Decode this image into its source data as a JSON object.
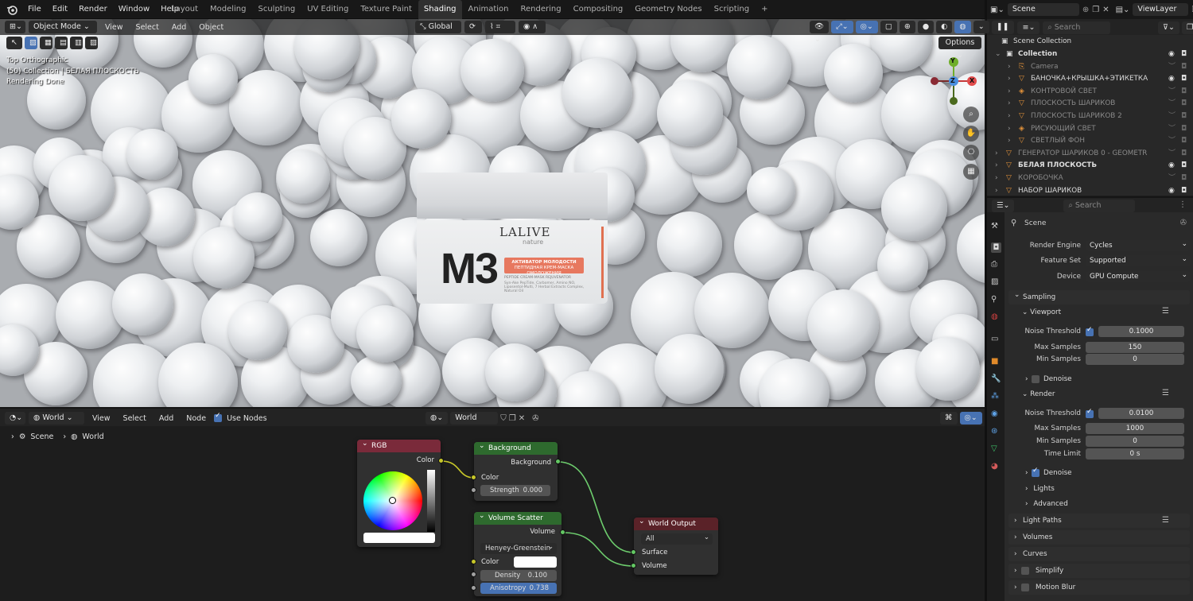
{
  "topbar": {
    "menus": [
      "File",
      "Edit",
      "Render",
      "Window",
      "Help"
    ],
    "workspaces": [
      "Layout",
      "Modeling",
      "Sculpting",
      "UV Editing",
      "Texture Paint",
      "Shading",
      "Animation",
      "Rendering",
      "Compositing",
      "Geometry Nodes",
      "Scripting"
    ],
    "active_workspace": "Shading",
    "add_tab": "+",
    "scene": "Scene",
    "view_layer": "ViewLayer"
  },
  "viewport": {
    "mode": "Object Mode",
    "menus": [
      "View",
      "Select",
      "Add",
      "Object"
    ],
    "transform": "Global",
    "options": "Options",
    "info": [
      "Top Orthographic",
      "(50) Collection | БЕЛАЯ ПЛОСКОСТЬ",
      "Rendering Done"
    ],
    "gizmo": {
      "y": "Y",
      "z": "Z",
      "x": "X"
    },
    "jar": {
      "brand": "LALIVE",
      "brand_sub": "nature",
      "product": "M3",
      "badge_line1": "АКТИВАТОР МОЛОДОСТИ",
      "badge_line2": "ПЕПТИДНАЯ КРЕМ-МАСКА ОМОЛОЖЕНИЯ",
      "fine1": "PEPTIDE CREAM-MASK REJUVENATOR",
      "fine2": "Syn-Ake PepTide, Carbomer, Amino NO, Liposentol-Multi, 7 Herbal Extracts Complex, Natural Oil"
    }
  },
  "node_editor": {
    "type": "World",
    "menus": [
      "View",
      "Select",
      "Add",
      "Node"
    ],
    "use_nodes": "Use Nodes",
    "world_name": "World",
    "breadcrumb": [
      "Scene",
      "World"
    ],
    "nodes": {
      "rgb": {
        "title": "RGB",
        "out": "Color"
      },
      "background": {
        "title": "Background",
        "out": "Background",
        "in_color": "Color",
        "strength_label": "Strength",
        "strength": "0.000"
      },
      "volume": {
        "title": "Volume Scatter",
        "out": "Volume",
        "phase": "Henyey-Greenstein",
        "in_color": "Color",
        "density_label": "Density",
        "density": "0.100",
        "aniso_label": "Anisotropy",
        "aniso": "0.738"
      },
      "output": {
        "title": "World Output",
        "target": "All",
        "surface": "Surface",
        "volume": "Volume"
      }
    },
    "colors": {
      "rgb_header": "#7a2a3a",
      "bg_header": "#2e6a2e",
      "output_header": "#5a2228",
      "wire": "#6dcc6d",
      "wire_yellow": "#c7c729",
      "sock_green": "#63c763",
      "sock_yellow": "#c7c729",
      "sock_grey": "#a1a1a1"
    }
  },
  "outliner": {
    "search": "Search",
    "root": "Scene Collection",
    "items": [
      {
        "name": "Collection",
        "indent": 0,
        "dim": false
      },
      {
        "name": "Camera",
        "indent": 1,
        "dim": true
      },
      {
        "name": "БАНОЧКА+КРЫШКА+ЭТИКЕТКА",
        "indent": 1,
        "dim": false
      },
      {
        "name": "КОНТРОВОЙ СВЕТ",
        "indent": 1,
        "dim": true
      },
      {
        "name": "ПЛОСКОСТЬ ШАРИКОВ",
        "indent": 1,
        "dim": true
      },
      {
        "name": "ПЛОСКОСТЬ ШАРИКОВ 2",
        "indent": 1,
        "dim": true
      },
      {
        "name": "РИСУЮЩИЙ СВЕТ",
        "indent": 1,
        "dim": true
      },
      {
        "name": "СВЕТЛЫЙ ФОН",
        "indent": 1,
        "dim": true
      },
      {
        "name": "ГЕНЕРАТОР ШАРИКОВ 0 - GEOMETR",
        "indent": 0,
        "dim": true
      },
      {
        "name": "БЕЛАЯ ПЛОСКОСТЬ",
        "indent": 0,
        "dim": false
      },
      {
        "name": "КОРОБОЧКА",
        "indent": 0,
        "dim": true
      },
      {
        "name": "НАБОР ШАРИКОВ",
        "indent": 0,
        "dim": false
      }
    ]
  },
  "properties": {
    "search": "Search",
    "context": "Scene",
    "render_engine_label": "Render Engine",
    "render_engine": "Cycles",
    "feature_set_label": "Feature Set",
    "feature_set": "Supported",
    "device_label": "Device",
    "device": "GPU Compute",
    "sampling": "Sampling",
    "viewport": "Viewport",
    "vp_noise_label": "Noise Threshold",
    "vp_noise": "0.1000",
    "vp_max_label": "Max Samples",
    "vp_max": "150",
    "vp_min_label": "Min Samples",
    "vp_min": "0",
    "denoise": "Denoise",
    "render": "Render",
    "r_noise_label": "Noise Threshold",
    "r_noise": "0.0100",
    "r_max_label": "Max Samples",
    "r_max": "1000",
    "r_min_label": "Min Samples",
    "r_min": "0",
    "time_label": "Time Limit",
    "time": "0 s",
    "denoise2": "Denoise",
    "lights": "Lights",
    "advanced": "Advanced",
    "light_paths": "Light Paths",
    "volumes": "Volumes",
    "curves": "Curves",
    "simplify": "Simplify",
    "motion_blur": "Motion Blur"
  }
}
